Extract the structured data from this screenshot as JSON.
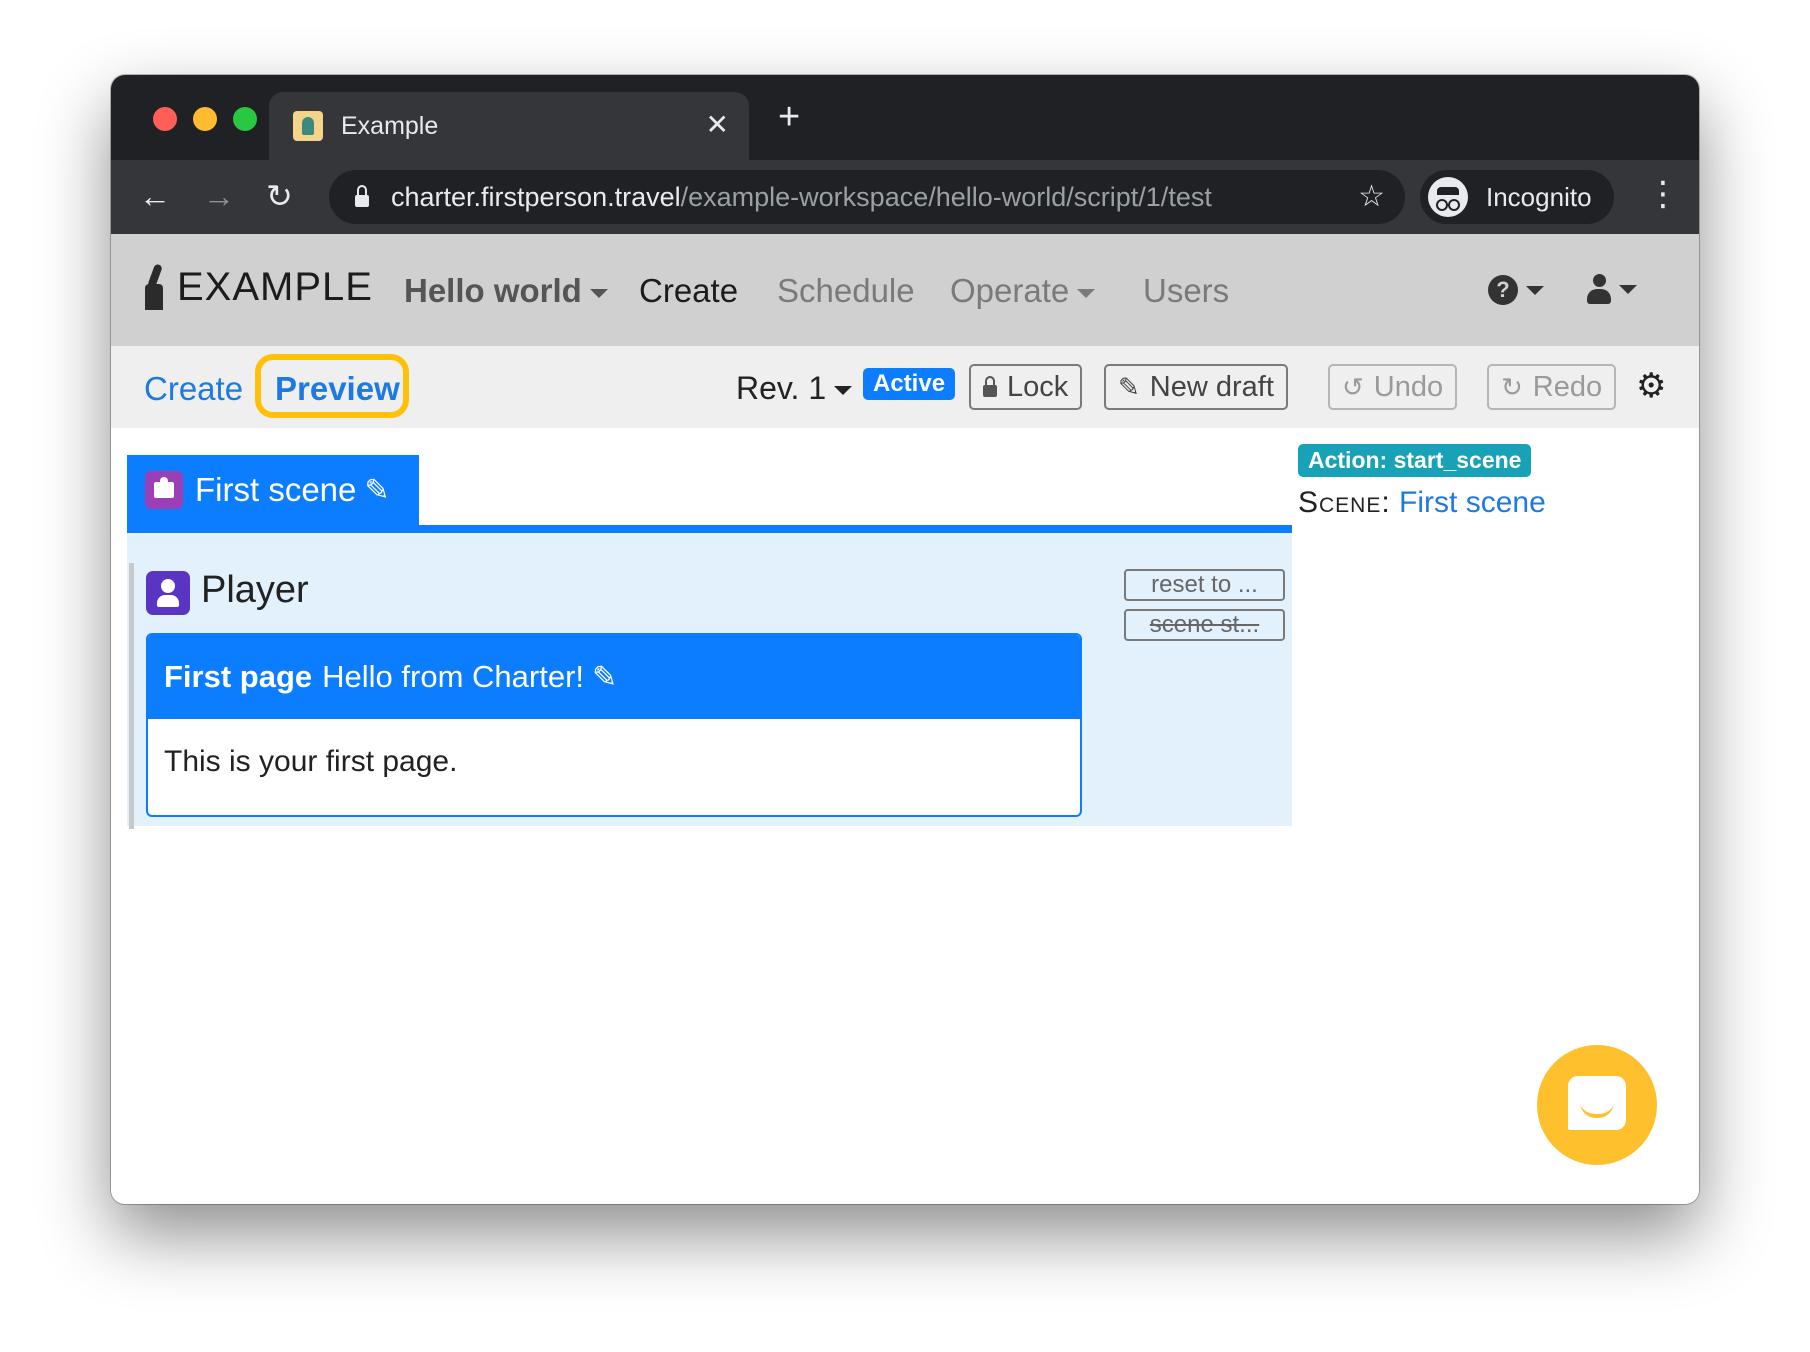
{
  "browser": {
    "tab_title": "Example",
    "close_glyph": "✕",
    "new_tab_glyph": "+",
    "back_glyph": "←",
    "forward_glyph": "→",
    "reload_glyph": "↻",
    "url_host": "charter.firstperson.travel",
    "url_path": "/example-workspace/hello-world/script/1/test",
    "star_glyph": "☆",
    "incognito_label": "Incognito",
    "menu_glyph": "⋮"
  },
  "app_nav": {
    "brand": "EXAMPLE",
    "project": "Hello world",
    "items": [
      "Create",
      "Schedule",
      "Operate",
      "Users"
    ],
    "help_glyph": "?"
  },
  "subbar": {
    "create_label": "Create",
    "preview_label": "Preview",
    "revision": "Rev. 1",
    "status_badge": "Active",
    "lock_label": "Lock",
    "new_draft_label": "New draft",
    "undo_label": "Undo",
    "redo_label": "Redo",
    "pencil_glyph": "✎",
    "undo_glyph": "↺",
    "redo_glyph": "↻",
    "gear_glyph": "⚙"
  },
  "scene": {
    "tab_label": "First scene",
    "pencil_glyph": "✎",
    "role_name": "Player",
    "page_name": "First page",
    "page_title": "Hello from Charter!",
    "page_text": "This is your first page.",
    "reset_button": "reset to ...",
    "scene_start_button": "scene st..."
  },
  "sidebar": {
    "action_badge": "Action: start_scene",
    "scene_label": "Scene:",
    "scene_link": "First scene"
  },
  "colors": {
    "accent": "#0d7dff",
    "highlight": "#ffc107",
    "chat_bubble": "#ffc02e",
    "action_badge": "#17a2b8"
  }
}
